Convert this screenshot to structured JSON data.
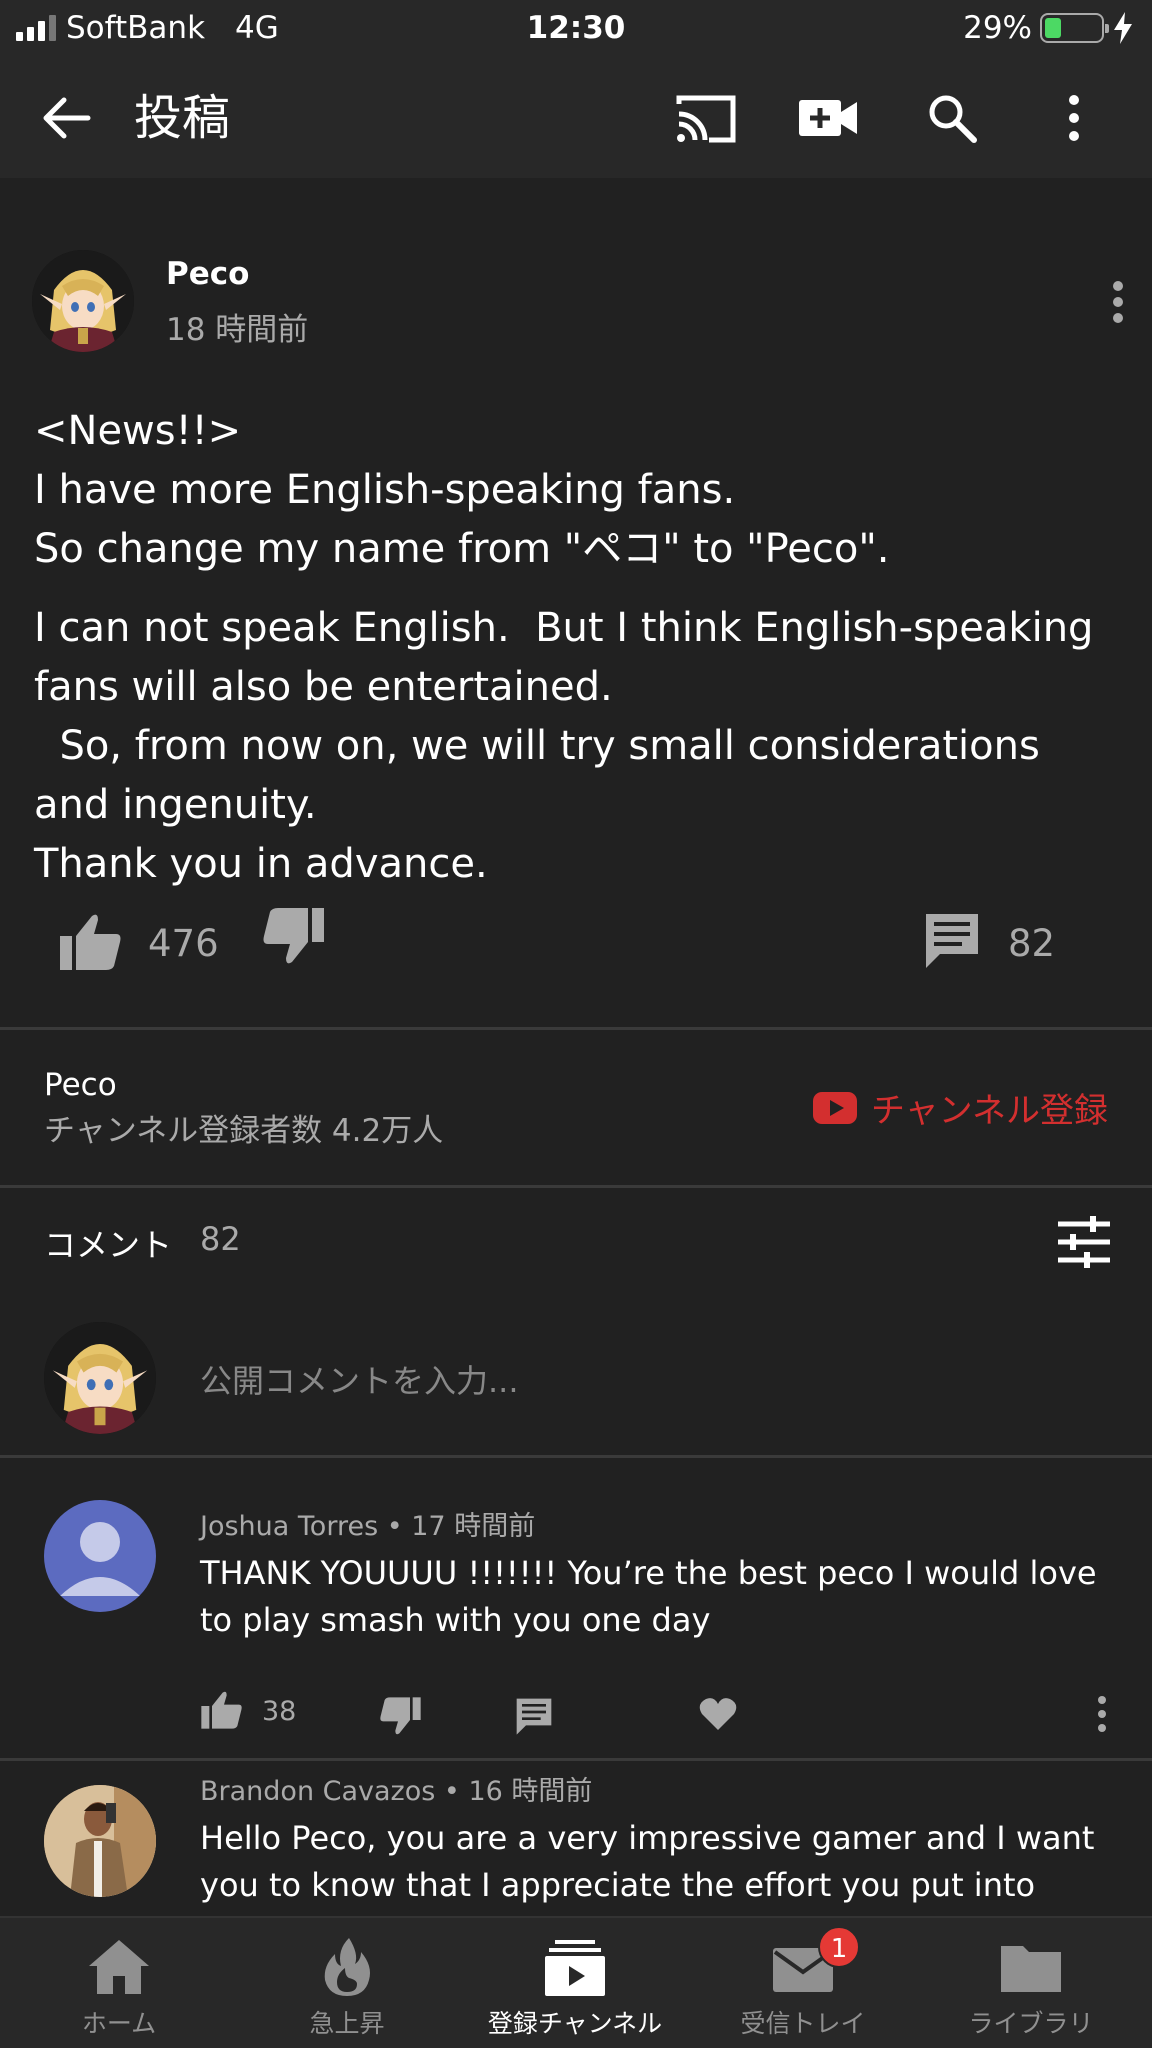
{
  "status_bar": {
    "carrier": "SoftBank",
    "network": "4G",
    "time": "12:30",
    "battery_percent": "29%",
    "battery_level": 0.29
  },
  "app_bar": {
    "title": "投稿",
    "icons": [
      "back-arrow-icon",
      "cast-icon",
      "video-camera-add-icon",
      "search-icon",
      "more-vert-icon"
    ]
  },
  "post": {
    "author": "Peco",
    "time": "18 時間前",
    "body_lines_1": "<News!!>\nI have more English-speaking fans.\nSo change my name from \"ペコ\" to \"Peco\".",
    "body_lines_2": "I can not speak English.  But I think English-speaking fans will also be entertained.\n  So, from now on, we will try small considerations and ingenuity.\nThank you in advance.",
    "likes": "476",
    "comments": "82"
  },
  "channel": {
    "name": "Peco",
    "subscribers": "チャンネル登録者数 4.2万人",
    "subscribe_label": "チャンネル登録",
    "accent_color": "#d32f2f"
  },
  "comments_header": {
    "label": "コメント",
    "count": "82"
  },
  "composer": {
    "placeholder": "公開コメントを入力..."
  },
  "comments": [
    {
      "author": "Joshua Torres",
      "time": "17 時間前",
      "text": "THANK YOUUUU !!!!!!! You’re the best peco I would love to play smash with you one day",
      "likes": "38"
    },
    {
      "author": "Brandon Cavazos",
      "time": "16 時間前",
      "text": "Hello Peco, you are a very impressive gamer and I want you to know that I appreciate the effort you put into reaching out"
    }
  ],
  "bottom_nav": {
    "items": [
      {
        "label": "ホーム",
        "icon": "home-icon"
      },
      {
        "label": "急上昇",
        "icon": "trending-icon"
      },
      {
        "label": "登録チャンネル",
        "icon": "subscriptions-icon"
      },
      {
        "label": "受信トレイ",
        "icon": "inbox-icon",
        "badge": "1"
      },
      {
        "label": "ライブラリ",
        "icon": "library-icon"
      }
    ],
    "active_index": 2
  }
}
